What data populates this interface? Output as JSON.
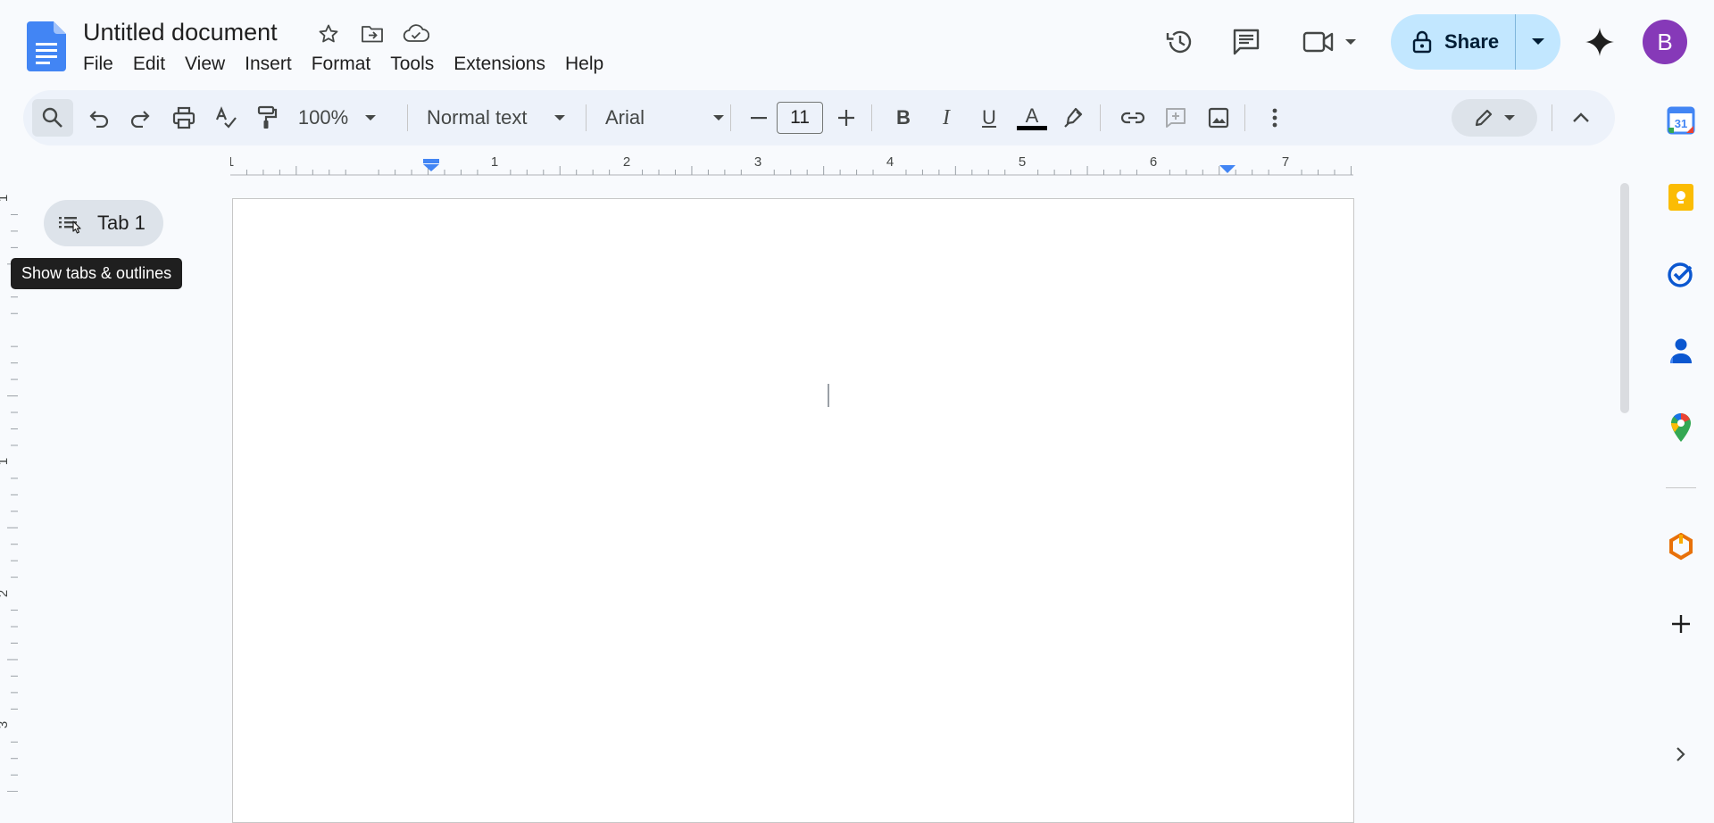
{
  "document": {
    "title": "Untitled document"
  },
  "menu": {
    "items": [
      "File",
      "Edit",
      "View",
      "Insert",
      "Format",
      "Tools",
      "Extensions",
      "Help"
    ]
  },
  "header": {
    "share_label": "Share",
    "avatar_initial": "B",
    "icons": [
      "star-icon",
      "move-folder-icon",
      "cloud-saved-icon",
      "history-icon",
      "comments-icon",
      "meet-video-icon",
      "gemini-icon"
    ]
  },
  "toolbar": {
    "zoom": "100%",
    "style": "Normal text",
    "font": "Arial",
    "font_size": "11",
    "bold": "B",
    "italic": "I",
    "underline": "U",
    "text_color_glyph": "A",
    "text_color": "#000000"
  },
  "ruler": {
    "horizontal_labels": [
      "1",
      "1",
      "2",
      "3",
      "4",
      "5",
      "6",
      "7"
    ],
    "vertical_labels": [
      "1",
      "1",
      "2",
      "3"
    ]
  },
  "tabs_panel": {
    "tab_label": "Tab 1",
    "tooltip": "Show tabs & outlines"
  },
  "side_panel": {
    "icons": [
      "calendar-icon",
      "keep-icon",
      "tasks-icon",
      "contacts-icon",
      "maps-icon",
      "addon-icon",
      "add-icon",
      "expand-icon"
    ],
    "calendar_date": "31"
  },
  "colors": {
    "accent": "#0b57d0",
    "share_bg": "#c2e7ff",
    "avatar_bg": "#8639b8",
    "toolbar_bg": "#edf2fa"
  }
}
